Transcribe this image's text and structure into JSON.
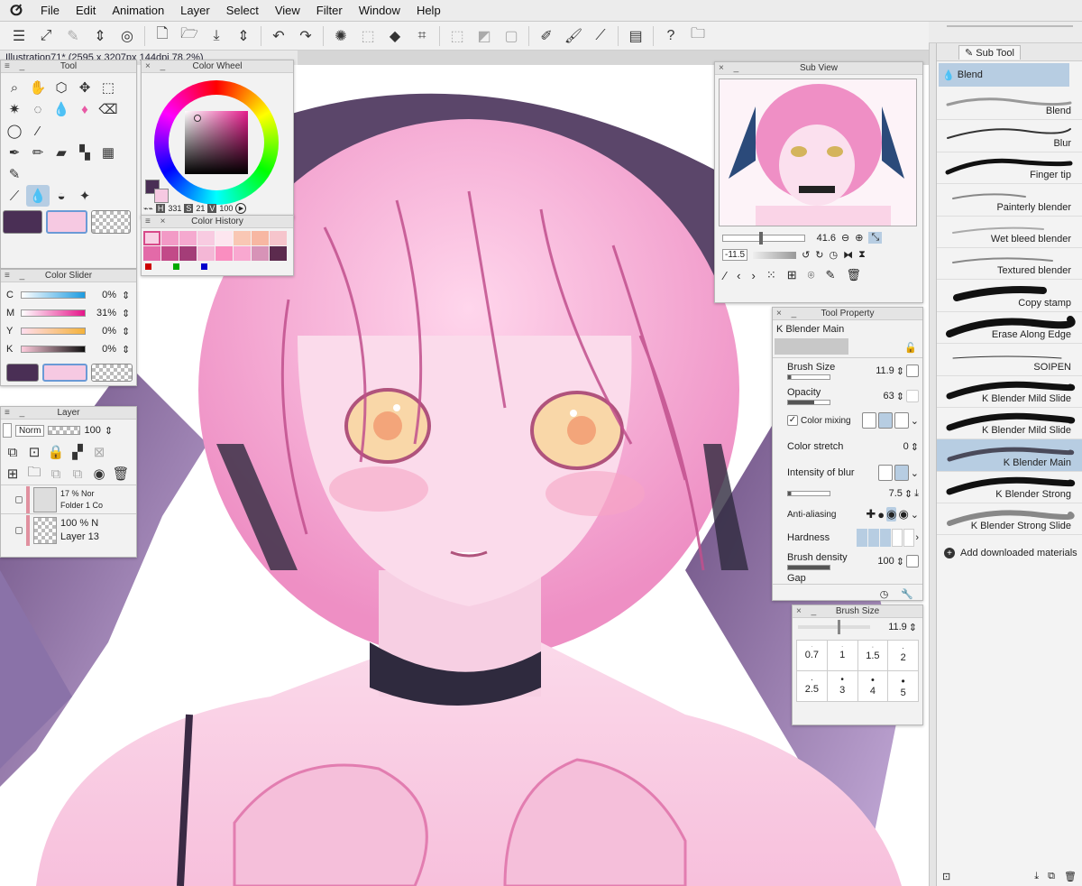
{
  "menubar": {
    "logo_glyph": "ⵚ",
    "items": [
      "File",
      "Edit",
      "Animation",
      "Layer",
      "Select",
      "View",
      "Filter",
      "Window",
      "Help"
    ]
  },
  "document_tab": {
    "title": "Illustration71* (2595 x 3207px 144dpi 78.2%)"
  },
  "tool_panel": {
    "title": "Tool"
  },
  "color_wheel": {
    "title": "Color Wheel",
    "h_label": "H",
    "h": "331",
    "s_label": "S",
    "s": "21",
    "v_label": "V",
    "v": "100"
  },
  "color_history": {
    "title": "Color History"
  },
  "color_slider": {
    "title": "Color Slider",
    "rows": [
      {
        "label": "C",
        "value": "0%",
        "level": 0
      },
      {
        "label": "M",
        "value": "31%",
        "level": 0.31
      },
      {
        "label": "Y",
        "value": "0%",
        "level": 0
      },
      {
        "label": "K",
        "value": "0%",
        "level": 0
      }
    ]
  },
  "layer_panel": {
    "title": "Layer",
    "blend_mode": "Norm",
    "opacity": "100",
    "layers": [
      {
        "opacity": "17 % Nor",
        "name": "Folder 1 Co"
      },
      {
        "opacity": "100 % N",
        "name": "Layer 13"
      }
    ]
  },
  "sub_view": {
    "title": "Sub View",
    "zoom": "41.6",
    "rotation": "-11.5"
  },
  "tool_property": {
    "title": "Tool Property",
    "tool_name": "K Blender Main",
    "brush_size_label": "Brush Size",
    "brush_size": "11.9",
    "opacity_label": "Opacity",
    "opacity": "63",
    "color_mixing_label": "Color mixing",
    "color_stretch_label": "Color stretch",
    "color_stretch": "0",
    "intensity_label": "Intensity of blur",
    "intensity": "7.5",
    "anti_aliasing_label": "Anti-aliasing",
    "hardness_label": "Hardness",
    "brush_density_label": "Brush density",
    "brush_density": "100",
    "gap_label": "Gap"
  },
  "brush_size_panel": {
    "title": "Brush Size",
    "value": "11.9",
    "sizes": [
      "0.7",
      "1",
      "1.5",
      "2",
      "2.5",
      "3",
      "4",
      "5"
    ]
  },
  "sub_tool": {
    "tab": "Sub Tool",
    "group": "Blend",
    "items": [
      "Blend",
      "Blur",
      "Finger tip",
      "Painterly blender",
      "Wet bleed blender",
      "Textured blender",
      "Copy stamp",
      "Erase Along Edge",
      "SOIPEN",
      "K Blender Mild Slide",
      "K Blender Mild Slide",
      "K Blender Main",
      "K Blender Strong",
      "K Blender Strong Slide"
    ],
    "selected_index": 11,
    "add_materials": "Add downloaded materials"
  },
  "colors": {
    "main_color": "#4a2f55",
    "sub_color": "#f6c9e2",
    "accent": "#b7cde2"
  }
}
